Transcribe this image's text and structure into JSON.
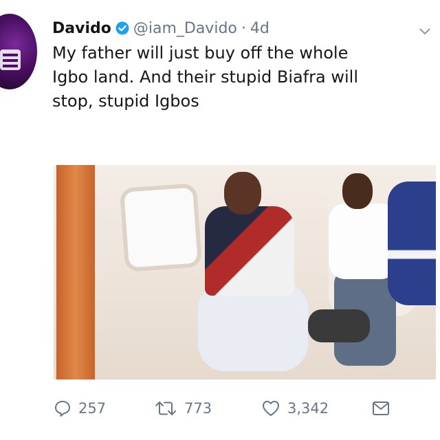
{
  "tweet": {
    "display_name": "Davido",
    "handle": "@iam_Davido",
    "separator": "·",
    "time": "4d",
    "text": "My father will just buy off the whole\nIgbo land. And their stupid Biafra will\nstop, stupid Igbos",
    "icons": {
      "verified": "verified-badge-icon",
      "menu": "chevron-down-icon",
      "reply": "reply-icon",
      "retweet": "retweet-icon",
      "like": "heart-icon",
      "dm": "envelope-icon"
    },
    "actions": {
      "reply_count": "257",
      "retweet_count": "773",
      "like_count": "3,342"
    }
  },
  "colors": {
    "text": "#14171a",
    "secondary": "#657786",
    "verified": "#1da1f2",
    "background": "#ffffff"
  }
}
